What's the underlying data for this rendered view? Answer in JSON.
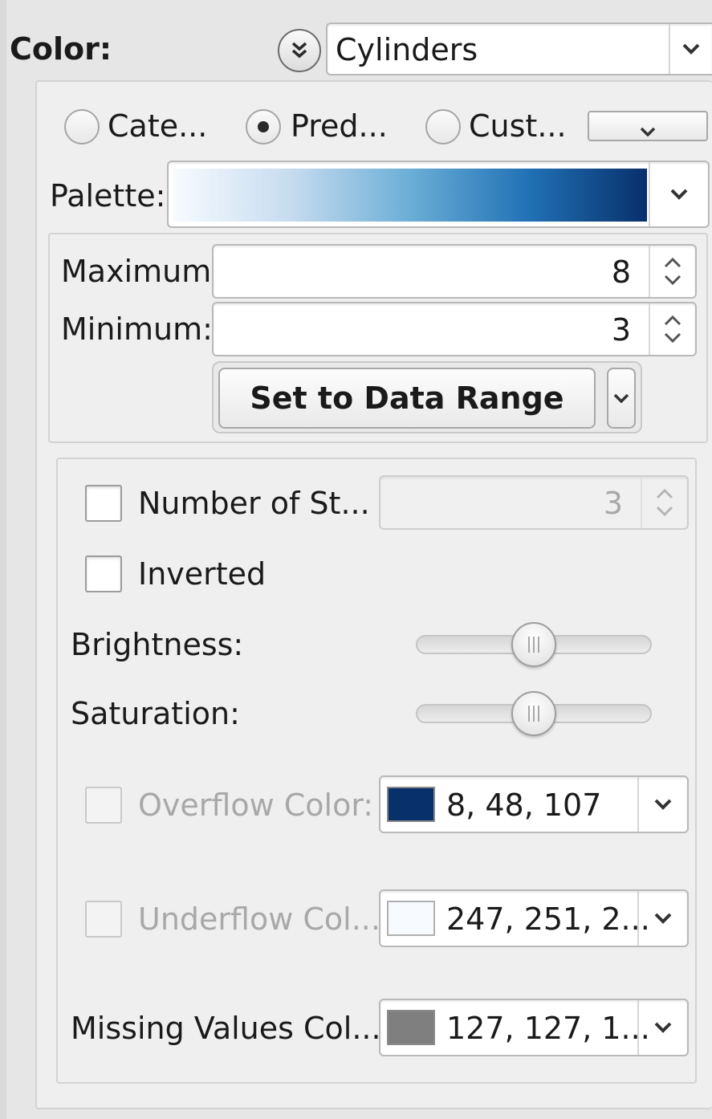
{
  "color": {
    "label": "Color:",
    "selected": "Cylinders",
    "expander_icon": "double-chevron-down-icon"
  },
  "modes": {
    "options": [
      {
        "label": "Cate...",
        "selected": false
      },
      {
        "label": "Pred...",
        "selected": true
      },
      {
        "label": "Cust...",
        "selected": false
      }
    ]
  },
  "palette": {
    "label": "Palette:",
    "gradient": [
      "#f7fbff",
      "#c6dbef",
      "#6baed6",
      "#2171b5",
      "#08306b"
    ]
  },
  "range": {
    "maximum_label": "Maximum:",
    "maximum_value": "8",
    "minimum_label": "Minimum:",
    "minimum_value": "3",
    "set_button_label": "Set to Data Range"
  },
  "options": {
    "steps_label": "Number of St...",
    "steps_value": "3",
    "steps_checked": false,
    "inverted_label": "Inverted",
    "inverted_checked": false,
    "brightness_label": "Brightness:",
    "brightness_level": 0.5,
    "saturation_label": "Saturation:",
    "saturation_level": 0.5
  },
  "overflow": {
    "label": "Overflow Color:",
    "value": "8, 48, 107",
    "swatch": "#08306b"
  },
  "underflow": {
    "label": "Underflow Col...",
    "value": "247, 251, 2...",
    "swatch": "#f7fbff"
  },
  "missing": {
    "label": "Missing Values Col...",
    "value": "127, 127, 1...",
    "swatch": "#7f7f7f"
  }
}
